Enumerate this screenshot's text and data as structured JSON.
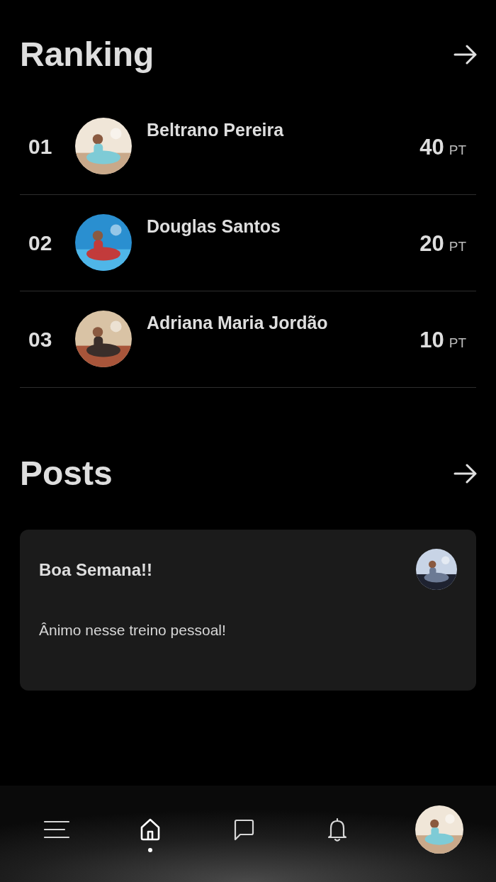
{
  "ranking": {
    "title": "Ranking",
    "entries": [
      {
        "rank": "01",
        "name": "Beltrano Pereira",
        "points": "40",
        "unit": "PT"
      },
      {
        "rank": "02",
        "name": "Douglas Santos",
        "points": "20",
        "unit": "PT"
      },
      {
        "rank": "03",
        "name": "Adriana Maria Jordão",
        "points": "10",
        "unit": "PT"
      }
    ]
  },
  "posts": {
    "title": "Posts",
    "items": [
      {
        "title": "Boa Semana!!",
        "body": "Ânimo nesse treino pessoal!"
      }
    ]
  },
  "nav": [
    {
      "kind": "menu",
      "selected": false
    },
    {
      "kind": "home",
      "selected": true
    },
    {
      "kind": "chat",
      "selected": false
    },
    {
      "kind": "bell",
      "selected": false
    },
    {
      "kind": "profile",
      "selected": false
    }
  ]
}
